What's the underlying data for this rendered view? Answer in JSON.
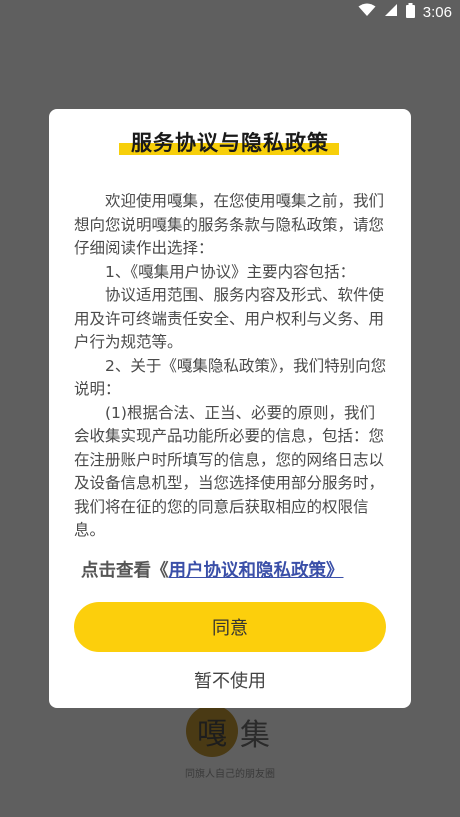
{
  "status_bar": {
    "time": "3:06",
    "icons": [
      "wifi-icon",
      "signal-icon",
      "battery-icon"
    ]
  },
  "splash": {
    "logo_char": "嘎",
    "logo_text": "集",
    "slogan": "同旗人自己的朋友圈"
  },
  "dialog": {
    "title": "服务协议与隐私政策",
    "paragraphs": [
      "欢迎使用嘎集，在您使用嘎集之前，我们想向您说明嘎集的服务条款与隐私政策，请您仔细阅读作出选择：",
      "1、《嘎集用户协议》主要内容包括：",
      "协议适用范围、服务内容及形式、软件使用及许可终端责任安全、用户权利与义务、用户行为规范等。",
      "2、关于《嘎集隐私政策》，我们特别向您说明：",
      "(1)根据合法、正当、必要的原则，我们会收集实现产品功能所必要的信息，包括：您在注册账户时所填写的信息，您的网络日志以及设备信息机型，当您选择使用部分服务时，我们将在征的您的同意后获取相应的权限信息。"
    ],
    "link_prefix": "点击查看《",
    "link_text": "用户协议和隐私政策",
    "link_suffix": "》",
    "agree_label": "同意",
    "decline_label": "暂不使用"
  },
  "colors": {
    "accent": "#fccf0c",
    "link": "#3a4fa8",
    "overlay": "#5f5f5f"
  }
}
